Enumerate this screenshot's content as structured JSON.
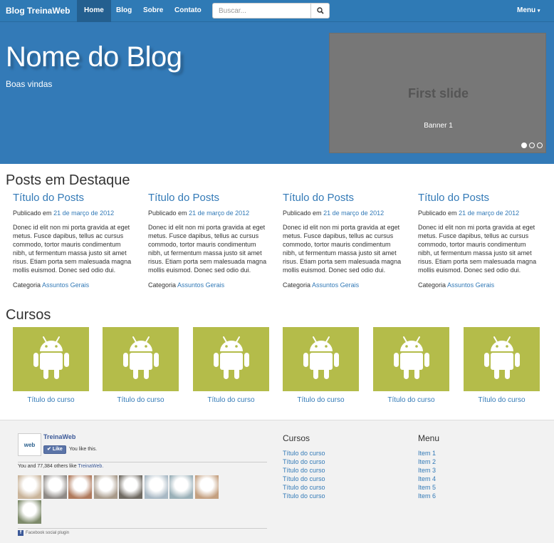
{
  "navbar": {
    "brand": "Blog TreinaWeb",
    "items": [
      {
        "label": "Home",
        "active": true
      },
      {
        "label": "Blog",
        "active": false
      },
      {
        "label": "Sobre",
        "active": false
      },
      {
        "label": "Contato",
        "active": false
      }
    ],
    "search_placeholder": "Buscar...",
    "menu_label": "Menu"
  },
  "hero": {
    "title": "Nome do Blog",
    "subtitle": "Boas vindas",
    "carousel": {
      "slide_title": "First slide",
      "caption": "Banner 1",
      "slide_count": 3,
      "active_index": 0
    }
  },
  "featured": {
    "heading": "Posts em Destaque",
    "posts": [
      {
        "title": "Título do Posts",
        "published_prefix": "Publicado em",
        "date": "21 de março de 2012",
        "body": "Donec id elit non mi porta gravida at eget metus. Fusce dapibus, tellus ac cursus commodo, tortor mauris condimentum nibh, ut fermentum massa justo sit amet risus. Etiam porta sem malesuada magna mollis euismod. Donec sed odio dui.",
        "category_prefix": "Categoria",
        "category": "Assuntos Gerais"
      },
      {
        "title": "Título do Posts",
        "published_prefix": "Publicado em",
        "date": "21 de março de 2012",
        "body": "Donec id elit non mi porta gravida at eget metus. Fusce dapibus, tellus ac cursus commodo, tortor mauris condimentum nibh, ut fermentum massa justo sit amet risus. Etiam porta sem malesuada magna mollis euismod. Donec sed odio dui.",
        "category_prefix": "Categoria",
        "category": "Assuntos Gerais"
      },
      {
        "title": "Título do Posts",
        "published_prefix": "Publicado em",
        "date": "21 de março de 2012",
        "body": "Donec id elit non mi porta gravida at eget metus. Fusce dapibus, tellus ac cursus commodo, tortor mauris condimentum nibh, ut fermentum massa justo sit amet risus. Etiam porta sem malesuada magna mollis euismod. Donec sed odio dui.",
        "category_prefix": "Categoria",
        "category": "Assuntos Gerais"
      },
      {
        "title": "Título do Posts",
        "published_prefix": "Publicado em",
        "date": "21 de março de 2012",
        "body": "Donec id elit non mi porta gravida at eget metus. Fusce dapibus, tellus ac cursus commodo, tortor mauris condimentum nibh, ut fermentum massa justo sit amet risus. Etiam porta sem malesuada magna mollis euismod. Donec sed odio dui.",
        "category_prefix": "Categoria",
        "category": "Assuntos Gerais"
      }
    ]
  },
  "courses": {
    "heading": "Cursos",
    "icon": "android-icon",
    "items": [
      {
        "title": "Título do curso"
      },
      {
        "title": "Título do curso"
      },
      {
        "title": "Título do curso"
      },
      {
        "title": "Título do curso"
      },
      {
        "title": "Título do curso"
      },
      {
        "title": "Título do curso"
      }
    ]
  },
  "footer": {
    "facebook": {
      "page_name": "TreinaWeb",
      "logo_text": "web",
      "like_label": "Like",
      "you_like": "You like this.",
      "count_text": "You and 77,384 others like",
      "count_link": "TreinaWeb.",
      "plugin_label": "Facebook social plugin",
      "faces": 9
    },
    "cursos": {
      "title": "Cursos",
      "links": [
        "Título do curso",
        "Título do curso",
        "Título do curso",
        "Título do curso",
        "Título do curso",
        "Título do curso"
      ]
    },
    "menu": {
      "title": "Menu",
      "links": [
        "Item 1",
        "Item 2",
        "Item 3",
        "Item 4",
        "Item 5",
        "Item 6"
      ]
    }
  },
  "colors": {
    "primary": "#337ab7",
    "navbar": "#2f7ab5",
    "course_tile": "#b4bc4a",
    "carousel_bg": "#777777",
    "footer_bg": "#f2f2f2"
  }
}
